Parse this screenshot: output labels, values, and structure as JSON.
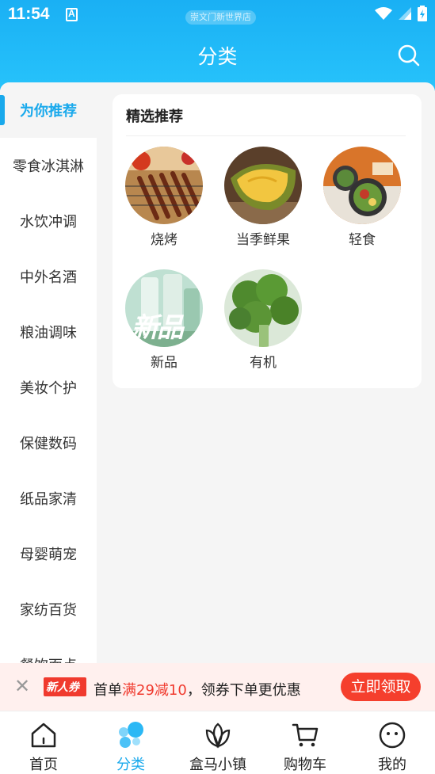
{
  "status_bar": {
    "time": "11:54",
    "location": "崇文门新世界店"
  },
  "header": {
    "title": "分类"
  },
  "sidebar": {
    "items": [
      {
        "label": "为你推荐",
        "active": true
      },
      {
        "label": "零食冰淇淋"
      },
      {
        "label": "水饮冲调"
      },
      {
        "label": "中外名酒"
      },
      {
        "label": "粮油调味"
      },
      {
        "label": "美妆个护"
      },
      {
        "label": "保健数码"
      },
      {
        "label": "纸品家清"
      },
      {
        "label": "母婴萌宠"
      },
      {
        "label": "家纺百货"
      },
      {
        "label": "餐饮面点"
      }
    ]
  },
  "section": {
    "title": "精选推荐",
    "categories": [
      {
        "label": "烧烤"
      },
      {
        "label": "当季鲜果"
      },
      {
        "label": "轻食"
      },
      {
        "label": "新品",
        "image_text": "新品"
      },
      {
        "label": "有机"
      }
    ]
  },
  "banner": {
    "tag": "新人券",
    "text_prefix": "首单",
    "text_highlight": "满29减10",
    "text_suffix": "，领券下单更优惠",
    "button": "立即领取"
  },
  "tabbar": {
    "tabs": [
      {
        "label": "首页"
      },
      {
        "label": "分类",
        "active": true
      },
      {
        "label": "盒马小镇"
      },
      {
        "label": "购物车"
      },
      {
        "label": "我的"
      }
    ]
  },
  "colors": {
    "accent": "#19a9ec",
    "header": "#1ab0f4",
    "promo": "#f53f2d"
  }
}
